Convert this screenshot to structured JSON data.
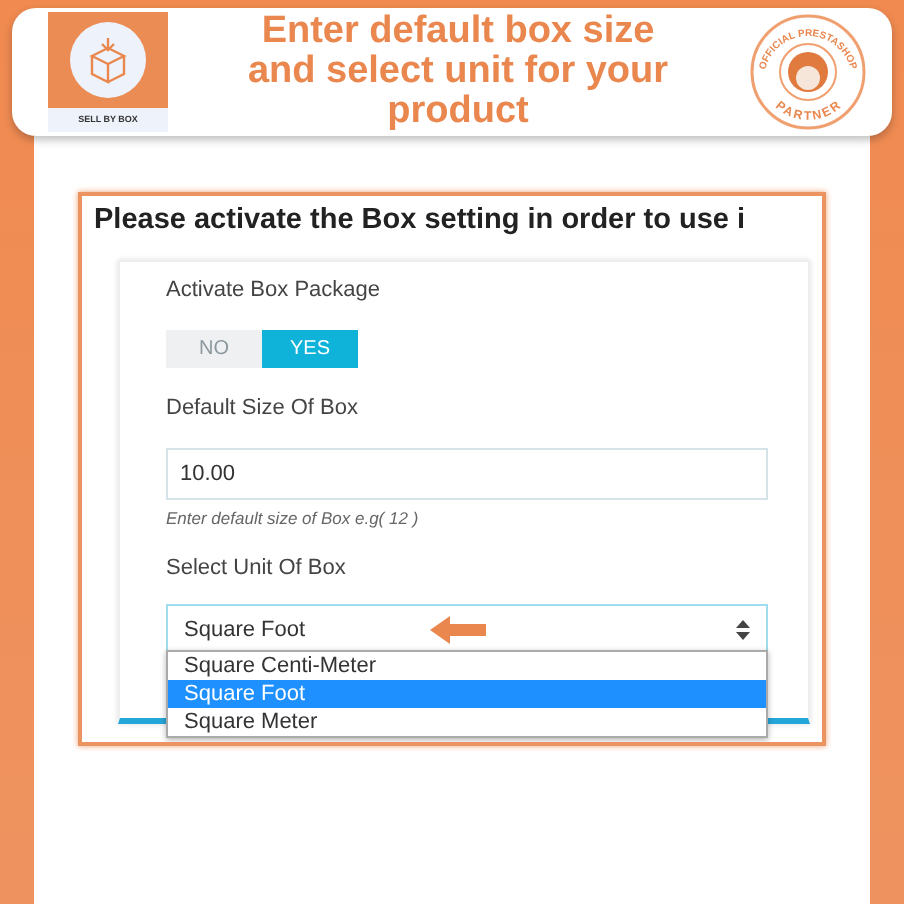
{
  "header": {
    "logo_caption": "SELL BY BOX",
    "title": "Enter default box size and select unit for your product",
    "badge": {
      "top_text": "OFFICIAL PRESTASHOP",
      "bottom_text": "PARTNER"
    }
  },
  "panel": {
    "heading": "Please activate the Box setting in order to use i",
    "activate": {
      "label": "Activate Box Package",
      "options": [
        {
          "label": "NO",
          "selected": false
        },
        {
          "label": "YES",
          "selected": true
        }
      ]
    },
    "size": {
      "label": "Default Size Of Box",
      "value": "10.00",
      "help": "Enter default size of Box e.g( 12 )"
    },
    "unit": {
      "label": "Select Unit Of Box",
      "value": "Square Foot",
      "options": [
        {
          "label": "Square Centi-Meter",
          "selected": false
        },
        {
          "label": "Square Foot",
          "selected": true
        },
        {
          "label": "Square Meter",
          "selected": false
        }
      ]
    }
  }
}
